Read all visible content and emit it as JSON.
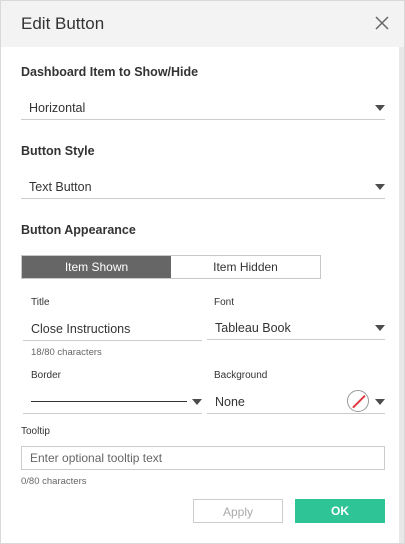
{
  "dialog": {
    "title": "Edit Button"
  },
  "show_hide": {
    "label": "Dashboard Item to Show/Hide",
    "value": "Horizontal"
  },
  "button_style": {
    "label": "Button Style",
    "value": "Text Button"
  },
  "appearance": {
    "label": "Button Appearance",
    "tabs": [
      {
        "label": "Item Shown",
        "active": true
      },
      {
        "label": "Item Hidden",
        "active": false
      }
    ],
    "title_field": {
      "label": "Title",
      "value": "Close Instructions",
      "char_count": "18/80 characters"
    },
    "font_field": {
      "label": "Font",
      "value": "Tableau Book"
    },
    "border_field": {
      "label": "Border"
    },
    "background_field": {
      "label": "Background",
      "value": "None",
      "swatch_icon": "no-color-icon"
    },
    "tooltip_field": {
      "label": "Tooltip",
      "placeholder": "Enter optional tooltip text",
      "char_count": "0/80 characters"
    }
  },
  "footer": {
    "apply_label": "Apply",
    "ok_label": "OK"
  },
  "colors": {
    "active_tab": "#666666",
    "ok_button": "#2ec495",
    "no_color_slash": "#e2383f"
  }
}
